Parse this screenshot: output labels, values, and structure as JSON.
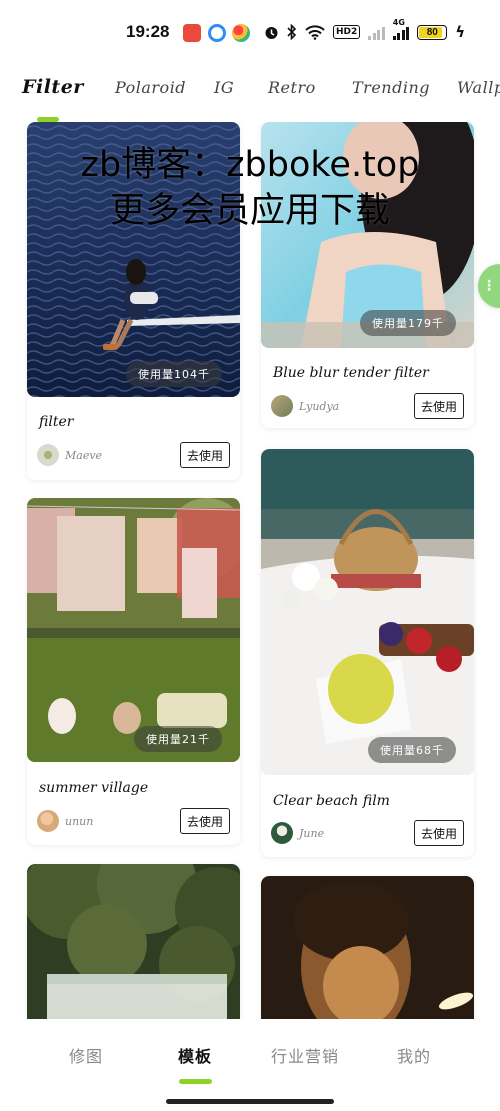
{
  "status_bar": {
    "time": "19:28",
    "signal_1": "HD2",
    "network": "4G",
    "battery": "80",
    "battery_level": 0.8,
    "icons": [
      "taobao-app-icon",
      "blue-app-icon",
      "photos-app-icon",
      "alarm-icon",
      "bluetooth-icon",
      "wifi-icon",
      "signal-icon",
      "battery-icon"
    ]
  },
  "tabs": [
    {
      "label": "Filter",
      "active": true
    },
    {
      "label": "Polaroid",
      "active": false
    },
    {
      "label": "IG",
      "active": false
    },
    {
      "label": "Retro",
      "active": false
    },
    {
      "label": "Trending",
      "active": false
    },
    {
      "label": "Wallpa",
      "active": false
    }
  ],
  "watermark": {
    "line1": "zb博客：zbboke.top",
    "line2": "更多会员应用下载"
  },
  "cards": [
    {
      "title": "filter",
      "author": "Maeve",
      "usage": "使用量104千",
      "button": "去使用"
    },
    {
      "title": "Blue blur tender filter",
      "author": "Lyudya",
      "usage": "使用量179千",
      "button": "去使用"
    },
    {
      "title": "summer village",
      "author": "unun",
      "usage": "使用量21千",
      "button": "去使用"
    },
    {
      "title": "Clear beach film",
      "author": "June",
      "usage": "使用量68千",
      "button": "去使用"
    },
    {
      "title": "",
      "author": "",
      "usage": "",
      "button": ""
    },
    {
      "title": "",
      "author": "",
      "usage": "",
      "button": ""
    }
  ],
  "bottom_nav": [
    {
      "label": "修图",
      "active": false
    },
    {
      "label": "模板",
      "active": true
    },
    {
      "label": "行业营销",
      "active": false
    },
    {
      "label": "我的",
      "active": false
    }
  ],
  "colors": {
    "accent": "#8fd12c",
    "float_handle": "#8fd87d",
    "battery": "#f2d21f"
  }
}
